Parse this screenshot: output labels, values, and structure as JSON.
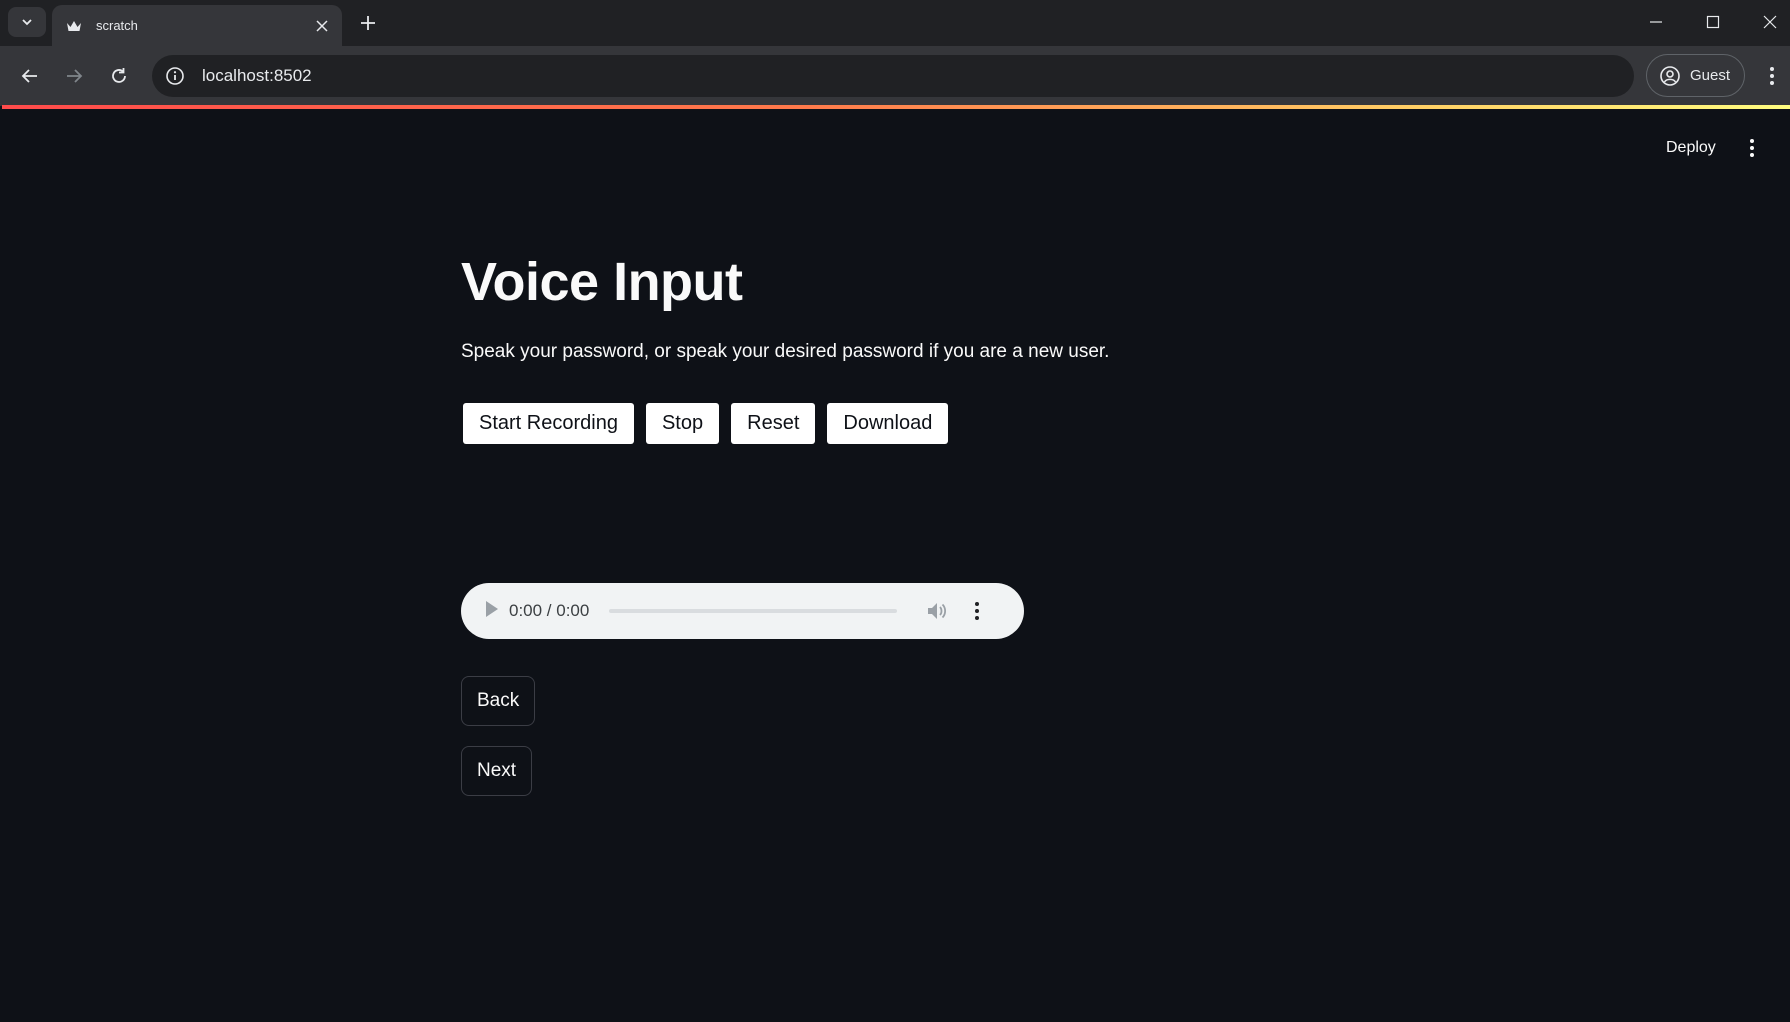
{
  "browser": {
    "tab": {
      "title": "scratch",
      "favicon": "crown-icon"
    },
    "url": "localhost:8502",
    "profile_label": "Guest"
  },
  "app": {
    "deploy_label": "Deploy",
    "title": "Voice Input",
    "subtitle": "Speak your password, or speak your desired password if you are a new user.",
    "recorder_buttons": [
      {
        "label": "Start Recording"
      },
      {
        "label": "Stop"
      },
      {
        "label": "Reset"
      },
      {
        "label": "Download"
      }
    ],
    "audio": {
      "time": "0:00 / 0:00"
    },
    "back_label": "Back",
    "next_label": "Next"
  },
  "colors": {
    "background": "#0e1117",
    "chrome_dark": "#202124",
    "chrome_toolbar": "#35363a",
    "accent_gradient_start": "#ff4b4b",
    "accent_gradient_end": "#fffd80"
  }
}
